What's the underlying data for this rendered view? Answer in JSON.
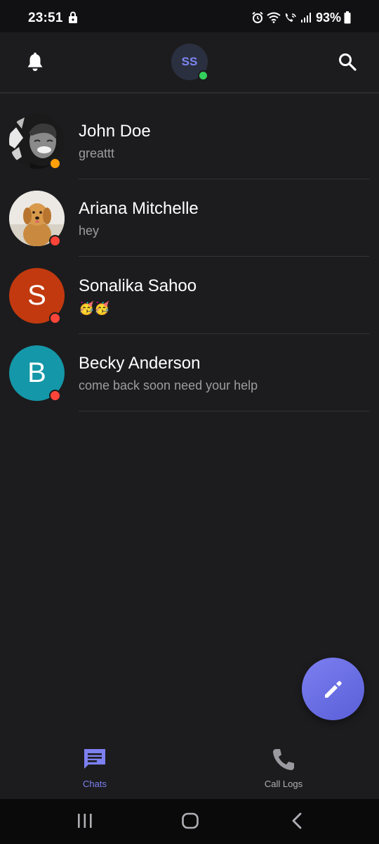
{
  "status_bar": {
    "time": "23:51",
    "battery": "93%",
    "icons": [
      "lock-icon",
      "alarm-icon",
      "wifi-icon",
      "wifi-call-icon",
      "signal-icon",
      "battery-icon"
    ]
  },
  "header": {
    "profile_initials": "SS",
    "left_icon": "bell-icon",
    "right_icon": "search-icon",
    "online_color": "#33d15c"
  },
  "chats": [
    {
      "name": "John Doe",
      "preview": "greattt",
      "avatar": "photo-man",
      "status_color": "#ff9f0a"
    },
    {
      "name": "Ariana Mitchelle",
      "preview": "hey",
      "avatar": "photo-dog",
      "status_color": "#ff453a"
    },
    {
      "name": "Sonalika Sahoo",
      "preview": "🥳🥳",
      "avatar_initial": "S",
      "avatar_color": "#c2390f",
      "status_color": "#ff453a"
    },
    {
      "name": "Becky Anderson",
      "preview": "come back soon need your help",
      "avatar_initial": "B",
      "avatar_color": "#1497a8",
      "status_color": "#ff453a"
    }
  ],
  "fab": {
    "icon": "pencil-icon",
    "color": "#6b6fe6"
  },
  "bottom_nav": {
    "items": [
      {
        "label": "Chats",
        "icon": "chat-icon",
        "active": true
      },
      {
        "label": "Call Logs",
        "icon": "phone-icon",
        "active": false
      }
    ],
    "active_color": "#7c80f0"
  },
  "system_nav": [
    "recents-icon",
    "home-icon",
    "back-icon"
  ]
}
